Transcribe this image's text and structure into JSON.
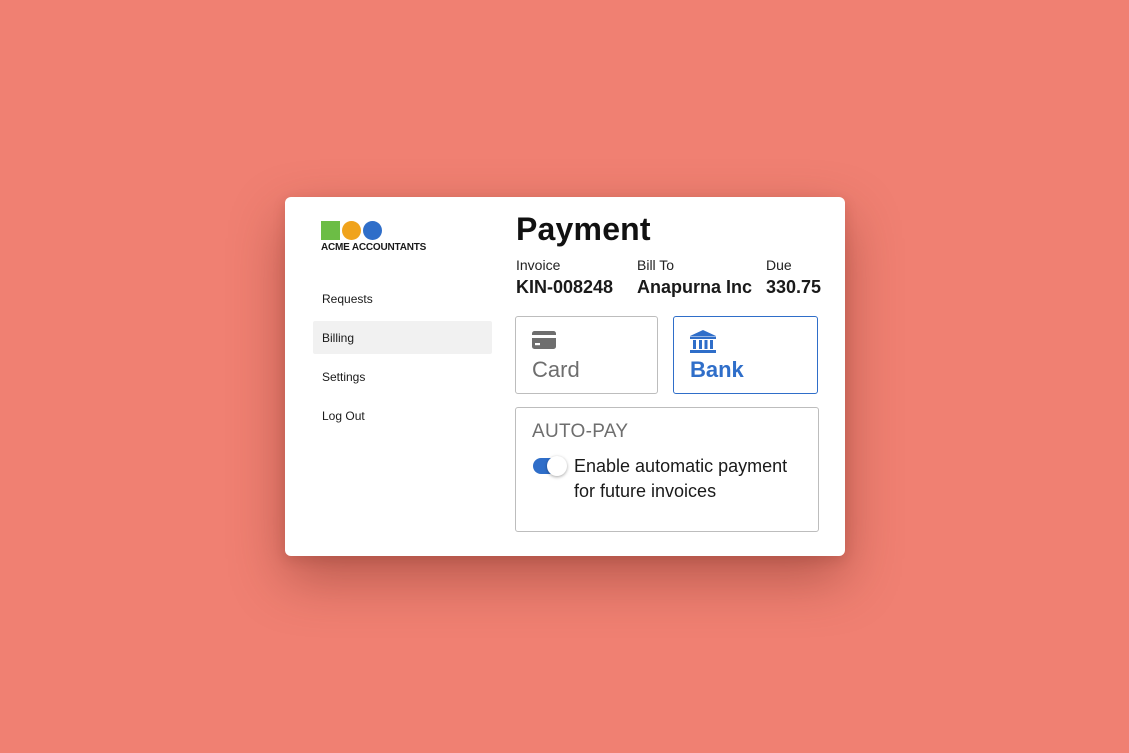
{
  "colors": {
    "background": "#f08072",
    "accent": "#2f6ec9",
    "logo_green": "#6cbd45",
    "logo_orange": "#f0a31c",
    "logo_blue": "#2f6ec9",
    "nav_active_bg": "#f1f1f1"
  },
  "logo": {
    "name": "ACME ACCOUNTANTS"
  },
  "nav": {
    "items": [
      {
        "label": "Requests",
        "active": false
      },
      {
        "label": "Billing",
        "active": true
      },
      {
        "label": "Settings",
        "active": false
      },
      {
        "label": "Log Out",
        "active": false
      }
    ]
  },
  "payment": {
    "title": "Payment",
    "invoice": {
      "label": "Invoice",
      "value": "KIN-008248"
    },
    "bill_to": {
      "label": "Bill To",
      "value": "Anapurna Inc"
    },
    "due": {
      "label": "Due",
      "value": "330.75"
    }
  },
  "methods": [
    {
      "label": "Card",
      "icon": "credit-card-icon",
      "selected": false
    },
    {
      "label": "Bank",
      "icon": "bank-icon",
      "selected": true
    }
  ],
  "autopay": {
    "title": "AUTO-PAY",
    "description": "Enable automatic payment for future invoices",
    "enabled": true
  }
}
